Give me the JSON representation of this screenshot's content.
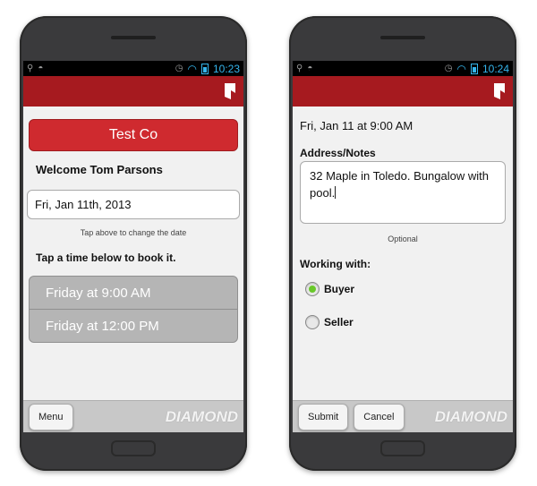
{
  "left_phone": {
    "status": {
      "time": "10:23"
    },
    "company_button": "Test Co",
    "welcome": "Welcome Tom Parsons",
    "date_field": {
      "value": "Fri, Jan 11th, 2013"
    },
    "date_hint": "Tap above to change the date",
    "instruction": "Tap a time below to book it.",
    "times": [
      "Friday at 9:00 AM",
      "Friday at 12:00 PM"
    ],
    "footer": {
      "menu": "Menu",
      "brand": "DIAMOND"
    }
  },
  "right_phone": {
    "status": {
      "time": "10:24"
    },
    "appointment": "Fri, Jan 11 at 9:00 AM",
    "notes_label": "Address/Notes",
    "notes_value": "32 Maple in Toledo. Bungalow with pool.",
    "optional": "Optional",
    "working_with_label": "Working with:",
    "options": [
      {
        "label": "Buyer",
        "selected": true
      },
      {
        "label": "Seller",
        "selected": false
      }
    ],
    "footer": {
      "submit": "Submit",
      "cancel": "Cancel",
      "brand": "DIAMOND"
    }
  },
  "colors": {
    "appbar": "#a61a1f",
    "company_button": "#cf2a2f",
    "status_accent": "#35b5ec",
    "radio_selected": "#69c82a"
  }
}
